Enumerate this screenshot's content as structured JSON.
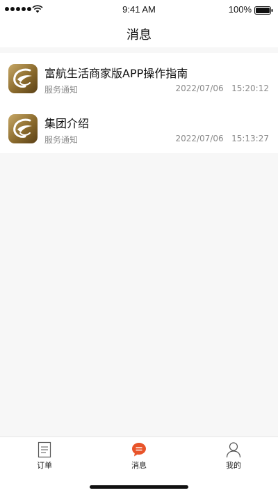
{
  "status_bar": {
    "time": "9:41 AM",
    "battery": "100%",
    "icons": [
      "signal-icon",
      "wifi-icon",
      "battery-icon"
    ]
  },
  "nav": {
    "title": "消息"
  },
  "messages": [
    {
      "title": "富航生活商家版APP操作指南",
      "subtitle": "服务通知",
      "date": "2022/07/06",
      "time": "15:20:12",
      "icon": "app-logo-icon"
    },
    {
      "title": "集团介绍",
      "subtitle": "服务通知",
      "date": "2022/07/06",
      "time": "15:13:27",
      "icon": "app-logo-icon"
    }
  ],
  "tabs": [
    {
      "label": "订单",
      "icon": "orders-icon",
      "active": false
    },
    {
      "label": "消息",
      "icon": "messages-icon",
      "active": true
    },
    {
      "label": "我的",
      "icon": "profile-icon",
      "active": false
    }
  ],
  "colors": {
    "accent": "#e8542a",
    "background": "#f7f7f7",
    "card": "#ffffff",
    "secondary_text": "#8a8a8a",
    "logo_gold": "#a4833f"
  }
}
